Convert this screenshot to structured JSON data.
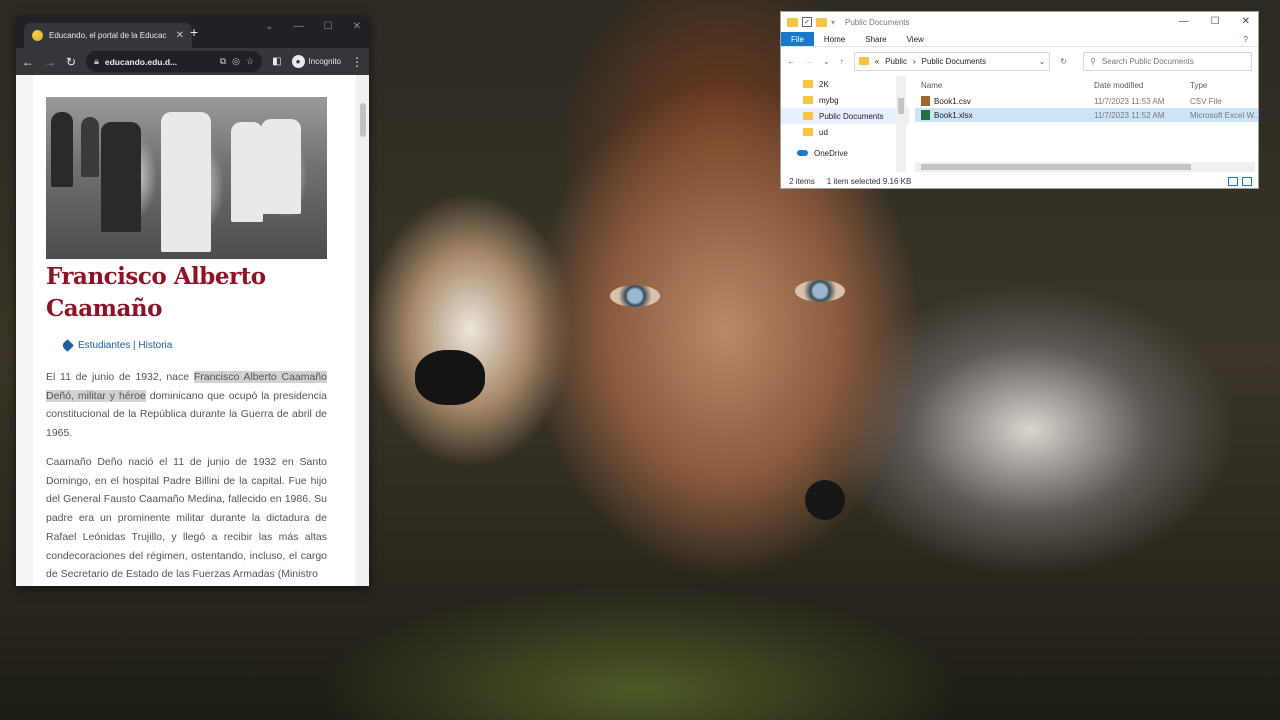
{
  "browser": {
    "tab_title": "Educando, el portal de la Educac",
    "tab_close": "✕",
    "new_tab": "+",
    "url": "educando.edu.d...",
    "incognito_label": "Incognito",
    "article": {
      "title": "Francisco Alberto Caamaño",
      "categories": "Estudiantes | Historia",
      "para1_a": "El 11 de junio de 1932, nace ",
      "para1_highlight": "Francisco Alberto Caamaño Deñó, militar y héroe",
      "para1_b": " dominicano que ocupó la presidencia constitucional de la República durante la Guerra de abril de 1965.",
      "para2": "Caamaño Deño nació el 11 de junio de 1932 en Santo Domingo, en el hospital Padre Billini de la capital. Fue hijo del General Fausto Caamaño Medina, fallecido en 1986. Su padre era un prominente militar durante la dictadura de Rafael Leónidas Trujillo, y llegó a recibir las más altas condecoraciones del régimen, ostentando, incluso, el cargo de Secretario de Estado de las Fuerzas Armadas (Ministro"
    }
  },
  "explorer": {
    "title": "Public Documents",
    "ribbon": [
      "File",
      "Home",
      "Share",
      "View"
    ],
    "breadcrumb": [
      "«",
      "Public",
      "›",
      "Public Documents"
    ],
    "search_placeholder": "Search Public Documents",
    "nav_items": [
      "2K",
      "mybg",
      "Public Documents",
      "ud",
      "OneDrive"
    ],
    "columns": [
      "Name",
      "Date modified",
      "Type"
    ],
    "files": [
      {
        "name": "Book1.csv",
        "date": "11/7/2023 11:53 AM",
        "type": "CSV File"
      },
      {
        "name": "Book1.xlsx",
        "date": "11/7/2023 11:52 AM",
        "type": "Microsoft Excel W..."
      }
    ],
    "status_items": "2 items",
    "status_selected": "1 item selected  9.16 KB"
  },
  "colors": {
    "headline": "#8e1326",
    "link": "#1d5fa0",
    "explorer_accent": "#1979ca"
  }
}
